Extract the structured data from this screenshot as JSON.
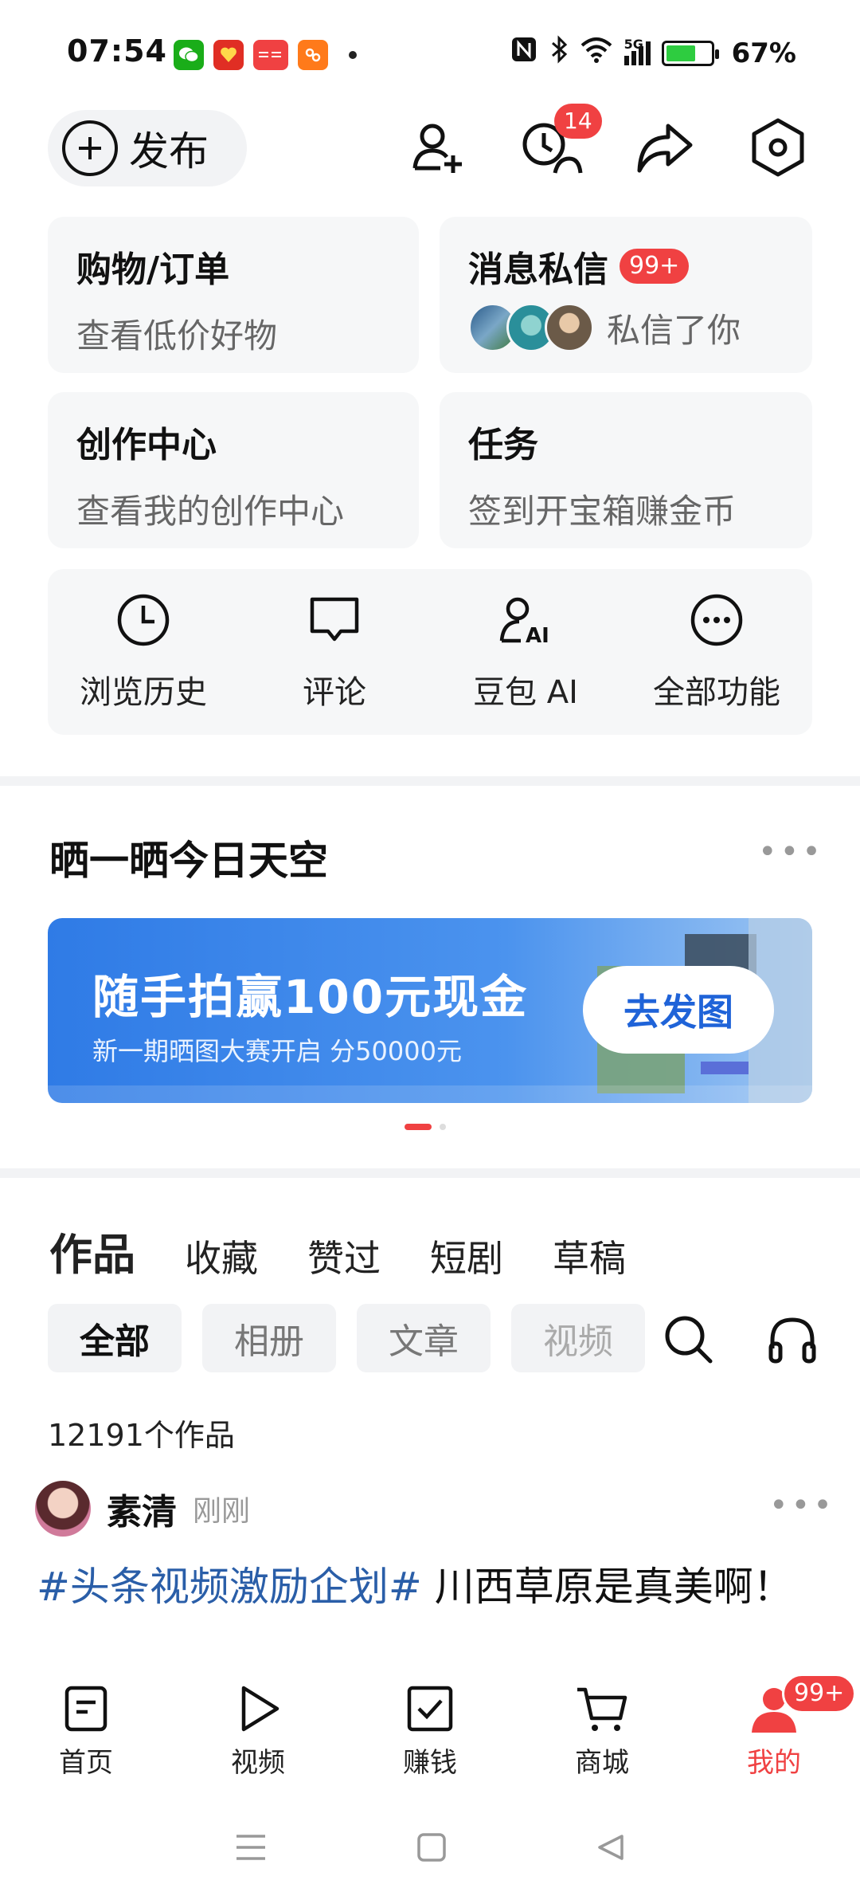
{
  "status_bar": {
    "time": "07:54",
    "network": "5G",
    "battery_percent": "67%",
    "battery_level": 0.67
  },
  "header": {
    "publish_label": "发布",
    "history_badge": "14"
  },
  "cards": {
    "shopping": {
      "title": "购物/订单",
      "subtitle": "查看低价好物"
    },
    "messages": {
      "title": "消息私信",
      "badge": "99+",
      "subtitle": "私信了你"
    },
    "creator": {
      "title": "创作中心",
      "subtitle": "查看我的创作中心"
    },
    "tasks": {
      "title": "任务",
      "subtitle": "签到开宝箱赚金币"
    }
  },
  "quick_actions": [
    {
      "label": "浏览历史",
      "icon": "clock-icon"
    },
    {
      "label": "评论",
      "icon": "comment-icon"
    },
    {
      "label": "豆包 AI",
      "icon": "ai-assistant-icon"
    },
    {
      "label": "全部功能",
      "icon": "more-icon"
    }
  ],
  "sky_section": {
    "title": "晒一晒今日天空",
    "banner_title": "随手拍赢100元现金",
    "banner_subtitle": "新一期晒图大赛开启 分50000元",
    "banner_button": "去发图"
  },
  "content_tabs": [
    "作品",
    "收藏",
    "赞过",
    "短剧",
    "草稿"
  ],
  "filter_chips": [
    "全部",
    "相册",
    "文章",
    "视频"
  ],
  "works_count": "12191个作品",
  "post": {
    "author": "素清",
    "time": "刚刚",
    "hashtag": "#头条视频激励企划#",
    "text": " 川西草原是真美啊！"
  },
  "bottom_nav": [
    {
      "label": "首页",
      "icon": "home-icon"
    },
    {
      "label": "视频",
      "icon": "video-play-icon"
    },
    {
      "label": "赚钱",
      "icon": "earn-checkbox-icon"
    },
    {
      "label": "商城",
      "icon": "cart-icon"
    },
    {
      "label": "我的",
      "icon": "profile-icon",
      "badge": "99+"
    }
  ],
  "colors": {
    "accent_red": "#f04142",
    "banner_blue": "#2f7be6",
    "hashtag_blue": "#2a5ea8"
  }
}
